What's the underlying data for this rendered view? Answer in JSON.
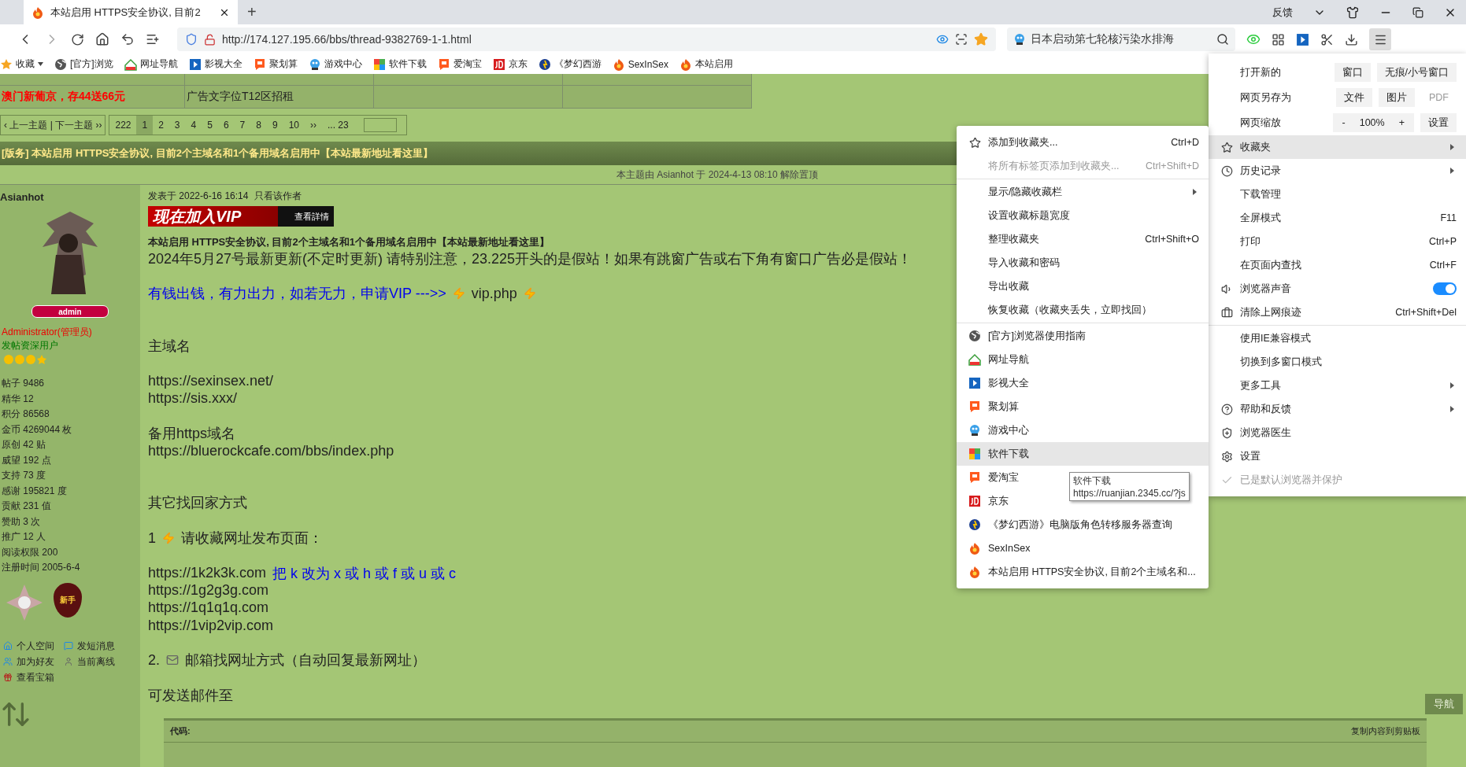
{
  "browser": {
    "tab": {
      "title": "本站启用 HTTPS安全协议, 目前2",
      "selected": true
    },
    "new_tab": "+",
    "feedback": "反馈",
    "url": "http://174.127.195.66/bbs/thread-9382769-1-1.html",
    "search": {
      "value": "日本启动第七轮核污染水排海"
    },
    "bookmarks": [
      {
        "kind": "star",
        "label": "收藏",
        "dropdown": true
      },
      {
        "kind": "globe",
        "label": "[官方]浏览",
        "dropdown": false
      },
      {
        "kind": "house",
        "label": "网址导航",
        "dropdown": false
      },
      {
        "kind": "film",
        "label": "影视大全",
        "dropdown": false
      },
      {
        "kind": "tao",
        "label": "聚划算",
        "dropdown": false
      },
      {
        "kind": "game",
        "label": "游戏中心",
        "dropdown": false
      },
      {
        "kind": "apps",
        "label": "软件下载",
        "dropdown": false
      },
      {
        "kind": "tao",
        "label": "爱淘宝",
        "dropdown": false
      },
      {
        "kind": "jd",
        "label": "京东",
        "dropdown": false
      },
      {
        "kind": "mhxy",
        "label": "《梦幻西游",
        "dropdown": false
      },
      {
        "kind": "flame",
        "label": "SexInSex",
        "dropdown": false
      },
      {
        "kind": "flame",
        "label": "本站启用",
        "dropdown": false
      }
    ]
  },
  "page": {
    "ad_rows": [
      [
        "",
        "",
        "",
        ""
      ],
      [
        "澳门新葡京，存44送66元",
        "广告文字位T12区招租",
        "",
        ""
      ]
    ],
    "pagination": {
      "nav": "‹ 上一主题 | 下一主题 ››",
      "pages": [
        {
          "label": "222",
          "selected": false
        },
        {
          "label": "1",
          "selected": true
        },
        {
          "label": "2",
          "selected": false
        },
        {
          "label": "3",
          "selected": false
        },
        {
          "label": "4",
          "selected": false
        },
        {
          "label": "5",
          "selected": false
        },
        {
          "label": "6",
          "selected": false
        },
        {
          "label": "7",
          "selected": false
        },
        {
          "label": "8",
          "selected": false
        },
        {
          "label": "9",
          "selected": false
        },
        {
          "label": "10",
          "selected": false
        },
        {
          "label": "››",
          "selected": false
        },
        {
          "label": "... 23",
          "selected": false
        }
      ]
    },
    "thread_title": "[版务] 本站启用 HTTPS安全协议, 目前2个主域名和1个备用域名启用中【本站最新地址看这里】",
    "moderation_note": "本主题由 Asianhot 于 2024-4-13 08:10 解除置顶",
    "author": {
      "name": "Asianhot",
      "badge": "admin",
      "role": "Administrator(管理员)",
      "group": "发帖资深用户",
      "stats": [
        {
          "label": "帖子",
          "value": "9486"
        },
        {
          "label": "精华",
          "value": "12"
        },
        {
          "label": "积分",
          "value": "86568"
        },
        {
          "label": "金币",
          "value": "4269044 枚"
        },
        {
          "label": "原创",
          "value": "42 贴"
        },
        {
          "label": "威望",
          "value": "192 点"
        },
        {
          "label": "支持",
          "value": "73 度"
        },
        {
          "label": "感谢",
          "value": "195821 度"
        },
        {
          "label": "贡献",
          "value": "231 值"
        },
        {
          "label": "赞助",
          "value": "3 次"
        },
        {
          "label": "推广",
          "value": "12 人"
        },
        {
          "label": "阅读权限",
          "value": "200"
        },
        {
          "label": "注册时间",
          "value": "2005-6-4"
        }
      ],
      "medal_label": "新手",
      "actions": [
        {
          "kind": "home",
          "label": "个人空间"
        },
        {
          "kind": "message",
          "label": "发短消息"
        },
        {
          "kind": "friends",
          "label": "加为好友"
        },
        {
          "kind": "person",
          "label": "当前离线"
        },
        {
          "kind": "chest",
          "label": "查看宝箱"
        }
      ]
    },
    "post": {
      "posted": "发表于 2022-6-16 16:14",
      "author_only": "只看该作者",
      "banner": {
        "title": "现在加入VIP",
        "link": "查看詳情"
      },
      "lines": [
        {
          "kind": "note",
          "parts": [
            {
              "kind": "text",
              "text": "本站启用 HTTPS安全协议, 目前2个主域名和1个备用域名启用中【本站最新地址看这里】"
            }
          ]
        },
        {
          "kind": "text",
          "parts": [
            {
              "kind": "text",
              "text": "2024年5月27号最新更新(不定时更新) 请特别注意，23.225开头的是假站！如果有跳窗广告或右下角有窗口广告必是假站！"
            }
          ]
        },
        {
          "kind": "gap"
        },
        {
          "kind": "text",
          "parts": [
            {
              "kind": "link",
              "text": "有钱出钱，有力出力，如若无力，申请VIP --->>"
            },
            {
              "kind": "bolt"
            },
            {
              "kind": "text",
              "text": "vip.php"
            },
            {
              "kind": "bolt"
            }
          ]
        },
        {
          "kind": "gap"
        },
        {
          "kind": "gap"
        },
        {
          "kind": "text",
          "parts": [
            {
              "kind": "text",
              "text": "主域名"
            }
          ]
        },
        {
          "kind": "gap"
        },
        {
          "kind": "text",
          "parts": [
            {
              "kind": "text",
              "text": "https://sexinsex.net/"
            }
          ]
        },
        {
          "kind": "text",
          "parts": [
            {
              "kind": "text",
              "text": "https://sis.xxx/"
            }
          ]
        },
        {
          "kind": "gap"
        },
        {
          "kind": "text",
          "parts": [
            {
              "kind": "text",
              "text": "备用https域名"
            }
          ]
        },
        {
          "kind": "text",
          "parts": [
            {
              "kind": "text",
              "text": "https://bluerockcafe.com/bbs/index.php"
            }
          ]
        },
        {
          "kind": "gap"
        },
        {
          "kind": "gap"
        },
        {
          "kind": "text",
          "parts": [
            {
              "kind": "text",
              "text": "其它找回家方式"
            }
          ]
        },
        {
          "kind": "gap"
        },
        {
          "kind": "text",
          "parts": [
            {
              "kind": "text",
              "text": "1"
            },
            {
              "kind": "bolt"
            },
            {
              "kind": "text",
              "text": "请收藏网址发布页面："
            }
          ]
        },
        {
          "kind": "gap"
        },
        {
          "kind": "text",
          "parts": [
            {
              "kind": "text",
              "text": "https://1k2k3k.com"
            },
            {
              "kind": "link",
              "text": "把 k 改为 x 或 h 或 f 或 u 或 c"
            }
          ]
        },
        {
          "kind": "text",
          "parts": [
            {
              "kind": "text",
              "text": "https://1g2g3g.com"
            }
          ]
        },
        {
          "kind": "text",
          "parts": [
            {
              "kind": "text",
              "text": "https://1q1q1q.com"
            }
          ]
        },
        {
          "kind": "text",
          "parts": [
            {
              "kind": "text",
              "text": "https://1vip2vip.com"
            }
          ]
        },
        {
          "kind": "gap"
        },
        {
          "kind": "text",
          "parts": [
            {
              "kind": "text",
              "text": "2."
            },
            {
              "kind": "mail"
            },
            {
              "kind": "text",
              "text": "邮箱找网址方式（自动回复最新网址）"
            }
          ]
        },
        {
          "kind": "gap"
        },
        {
          "kind": "text",
          "parts": [
            {
              "kind": "text",
              "text": "可发送邮件至"
            }
          ]
        }
      ],
      "code": {
        "label": "代码:",
        "copy": "复制内容到剪贴板"
      }
    },
    "nav_button": "导航"
  },
  "main_menu": {
    "top_rows": [
      {
        "label": "打开新的",
        "buttons": [
          "窗口",
          "无痕/小号窗口"
        ]
      },
      {
        "label": "网页另存为",
        "buttons": [
          "文件",
          "图片",
          "PDF"
        ]
      }
    ],
    "zoom": {
      "label": "网页缩放",
      "minus": "-",
      "value": "100%",
      "plus": "+",
      "settings": "设置"
    },
    "groups": [
      [
        {
          "kind": "star",
          "label": "收藏夹",
          "arrow": true,
          "selected": true,
          "disabled": false
        },
        {
          "kind": "clock",
          "label": "历史记录",
          "arrow": true,
          "selected": false,
          "disabled": false
        },
        {
          "kind": "plain",
          "label": "下载管理",
          "arrow": false,
          "selected": false,
          "disabled": false
        },
        {
          "kind": "plain",
          "label": "全屏模式",
          "shortcut": "F11",
          "arrow": false,
          "selected": false,
          "disabled": false
        },
        {
          "kind": "plain",
          "label": "打印",
          "shortcut": "Ctrl+P",
          "arrow": false,
          "selected": false,
          "disabled": false
        },
        {
          "kind": "plain",
          "label": "在页面内查找",
          "shortcut": "Ctrl+F",
          "arrow": false,
          "selected": false,
          "disabled": false
        },
        {
          "kind": "speaker",
          "label": "浏览器声音",
          "arrow": false,
          "selected": false,
          "disabled": false,
          "on": true
        },
        {
          "kind": "briefcase",
          "label": "清除上网痕迹",
          "shortcut": "Ctrl+Shift+Del",
          "arrow": false,
          "selected": false,
          "disabled": false
        }
      ],
      [
        {
          "kind": "plain",
          "label": "使用IE兼容模式",
          "arrow": false,
          "selected": false,
          "disabled": false
        },
        {
          "kind": "plain",
          "label": "切换到多窗口模式",
          "arrow": false,
          "selected": false,
          "disabled": false
        },
        {
          "kind": "plain",
          "label": "更多工具",
          "arrow": true,
          "selected": false,
          "disabled": false
        },
        {
          "kind": "help",
          "label": "帮助和反馈",
          "arrow": true,
          "selected": false,
          "disabled": false
        },
        {
          "kind": "shield",
          "label": "浏览器医生",
          "arrow": false,
          "selected": false,
          "disabled": false
        },
        {
          "kind": "gear",
          "label": "设置",
          "arrow": false,
          "selected": false,
          "disabled": false
        },
        {
          "kind": "check",
          "label": "已是默认浏览器并保护",
          "arrow": false,
          "selected": false,
          "disabled": true
        }
      ]
    ]
  },
  "favorites_menu": {
    "groups": [
      [
        {
          "kind": "star",
          "label": "添加到收藏夹...",
          "shortcut": "Ctrl+D",
          "arrow": false,
          "selected": false,
          "disabled": false
        },
        {
          "kind": "plain",
          "label": "将所有标签页添加到收藏夹...",
          "shortcut": "Ctrl+Shift+D",
          "arrow": false,
          "selected": false,
          "disabled": true
        }
      ],
      [
        {
          "kind": "plain",
          "label": "显示/隐藏收藏栏",
          "arrow": true,
          "selected": false,
          "disabled": false
        },
        {
          "kind": "plain",
          "label": "设置收藏标题宽度",
          "arrow": false,
          "selected": false,
          "disabled": false
        },
        {
          "kind": "plain",
          "label": "整理收藏夹",
          "shortcut": "Ctrl+Shift+O",
          "arrow": false,
          "selected": false,
          "disabled": false
        },
        {
          "kind": "plain",
          "label": "导入收藏和密码",
          "arrow": false,
          "selected": false,
          "disabled": false
        },
        {
          "kind": "plain",
          "label": "导出收藏",
          "arrow": false,
          "selected": false,
          "disabled": false
        },
        {
          "kind": "plain",
          "label": "恢复收藏（收藏夹丢失，立即找回）",
          "arrow": false,
          "selected": false,
          "disabled": false
        }
      ],
      [
        {
          "kind": "globe",
          "label": "[官方]浏览器使用指南",
          "arrow": false,
          "selected": false,
          "disabled": false
        },
        {
          "kind": "house",
          "label": "网址导航",
          "arrow": false,
          "selected": false,
          "disabled": false
        },
        {
          "kind": "film",
          "label": "影视大全",
          "arrow": false,
          "selected": false,
          "disabled": false
        },
        {
          "kind": "tao",
          "label": "聚划算",
          "arrow": false,
          "selected": false,
          "disabled": false
        },
        {
          "kind": "game",
          "label": "游戏中心",
          "arrow": false,
          "selected": false,
          "disabled": false
        },
        {
          "kind": "apps",
          "label": "软件下载",
          "arrow": false,
          "selected": true,
          "disabled": false
        },
        {
          "kind": "tao",
          "label": "爱淘宝",
          "arrow": false,
          "selected": false,
          "disabled": false
        },
        {
          "kind": "jd",
          "label": "京东",
          "arrow": false,
          "selected": false,
          "disabled": false
        },
        {
          "kind": "mhxy",
          "label": "《梦幻西游》电脑版角色转移服务器查询",
          "arrow": false,
          "selected": false,
          "disabled": false
        },
        {
          "kind": "flame",
          "label": "SexInSex",
          "arrow": false,
          "selected": false,
          "disabled": false
        },
        {
          "kind": "flame",
          "label": "本站启用 HTTPS安全协议, 目前2个主域名和...",
          "arrow": false,
          "selected": false,
          "disabled": false
        }
      ]
    ]
  },
  "tooltip": [
    "软件下载",
    "https://ruanjian.2345.cc/?js"
  ]
}
